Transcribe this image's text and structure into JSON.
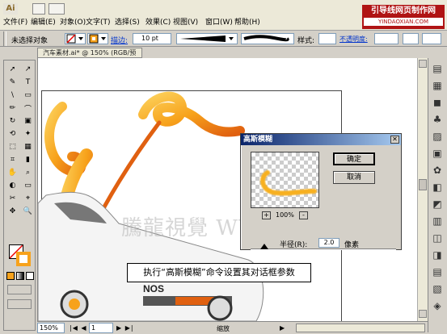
{
  "app": {
    "logo": "Ai"
  },
  "menu": [
    "文件(F)",
    "编辑(E)",
    "对象(O)",
    "文字(T)",
    "选择(S)",
    "效果(C)",
    "视图(V)",
    "窗口(W)",
    "帮助(H)"
  ],
  "brand": {
    "line1": "引导线网页制作网",
    "line2": "YINDAOXIAN.COM"
  },
  "control": {
    "selection_status": "未选择对象",
    "stroke_label": "描边:",
    "stroke_weight": "10 pt",
    "style_label": "样式:",
    "opacity_label": "不透明度:"
  },
  "document": {
    "tab_title": "汽车素材.ai* @ 150% (RGB/预览)"
  },
  "status": {
    "zoom": "150%",
    "page": "1",
    "tool_label": "缩放"
  },
  "dialog": {
    "title": "高斯模糊",
    "ok": "确定",
    "cancel": "取消",
    "preview_zoom": "100%",
    "radius_label": "半径(R):",
    "radius_value": "2.0",
    "radius_unit": "像素"
  },
  "watermark": "騰龍視覺 WWW.TLVI.NET",
  "caption": "执行“高斯模糊”命令设置其对话框参数",
  "artwork": {
    "nos_label": "NOS"
  },
  "colors": {
    "orange": "#f7a21b",
    "dark_orange": "#e06010",
    "titlebar": "#0a246a"
  }
}
